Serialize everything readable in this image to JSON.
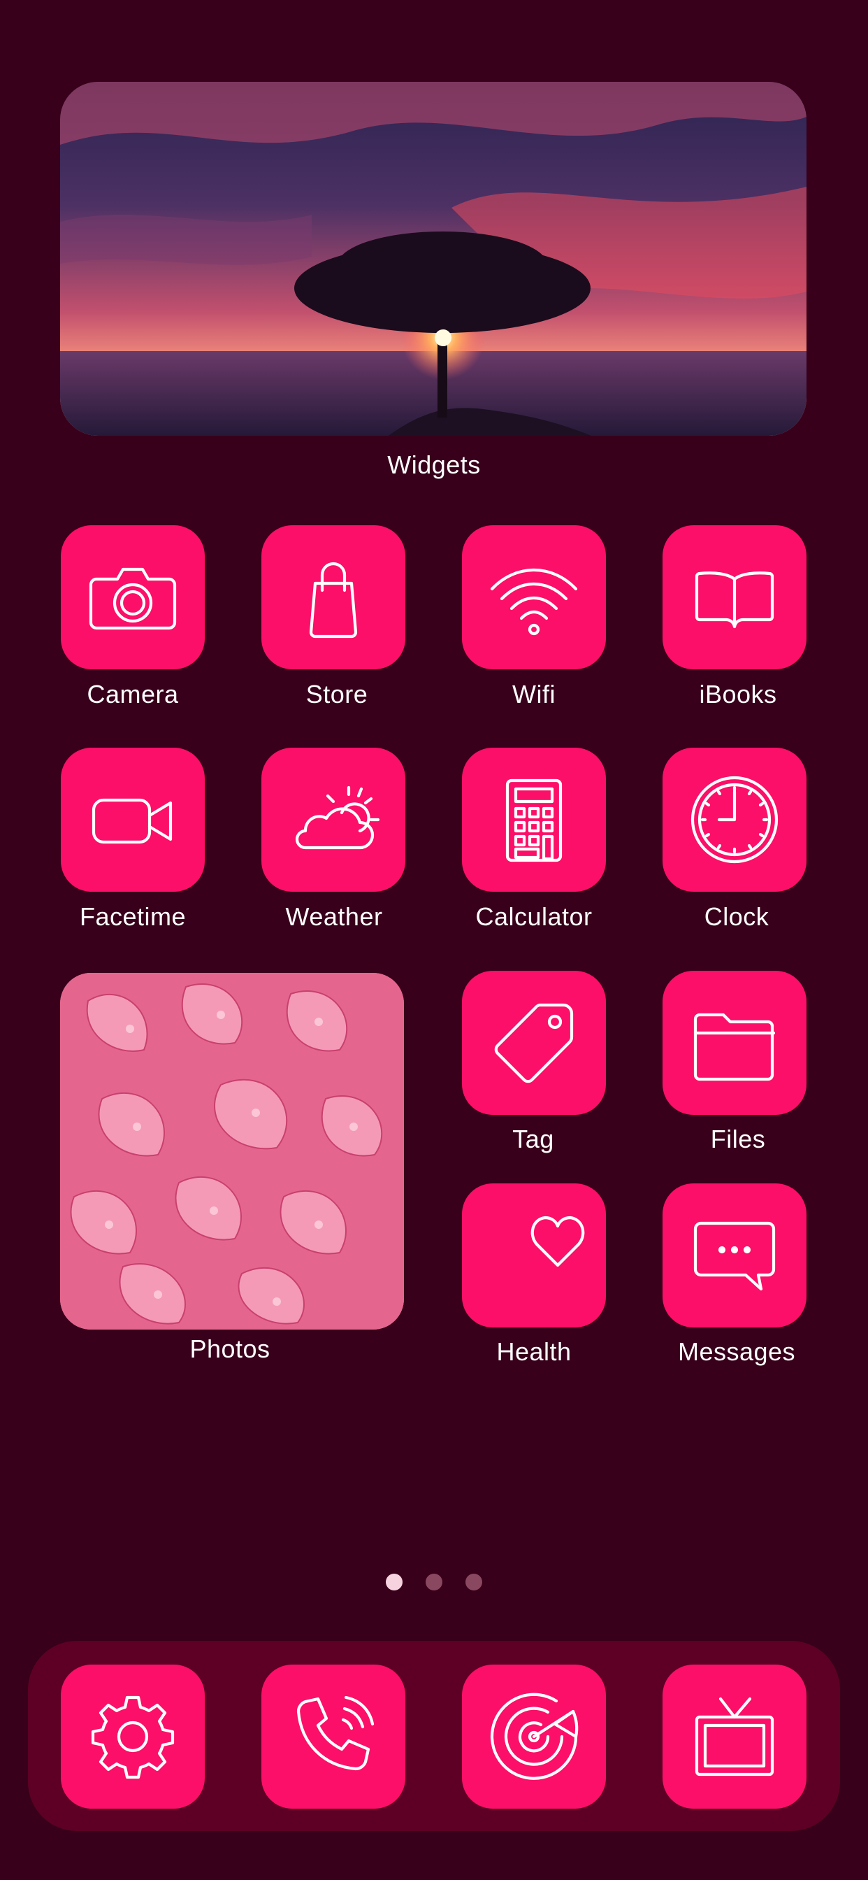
{
  "widgets": {
    "label": "Widgets"
  },
  "apps": {
    "camera": "Camera",
    "store": "Store",
    "wifi": "Wifi",
    "ibooks": "iBooks",
    "facetime": "Facetime",
    "weather": "Weather",
    "calculator": "Calculator",
    "clock": "Clock",
    "photos": "Photos",
    "tag": "Tag",
    "files": "Files",
    "health": "Health",
    "messages": "Messages"
  },
  "page_indicator": {
    "count": 3,
    "active_index": 0
  },
  "dock": {
    "icons": [
      "gear-icon",
      "phone-icon",
      "radar-icon",
      "tv-icon"
    ]
  },
  "colors": {
    "background": "#38001a",
    "tile": "#fc0f68",
    "dock": "#5e0025"
  }
}
